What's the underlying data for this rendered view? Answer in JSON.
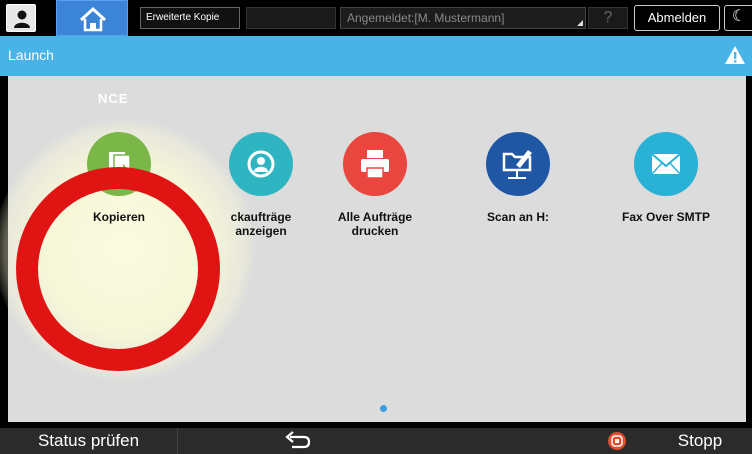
{
  "topbar": {
    "function_label": "Erweiterte Kopie",
    "login_text": "Angemeldet:[M. Mustermann]",
    "help_label": "?",
    "logout_label": "Abmelden",
    "moon_glyph": "☾"
  },
  "header": {
    "title": "Launch"
  },
  "main": {
    "section_label": "NCE",
    "apps": [
      {
        "line1": "Kopieren",
        "line2": "",
        "color": "#7ab648",
        "icon": "copy-icon"
      },
      {
        "line1": "ckaufträge",
        "line2": "anzeigen",
        "color": "#2fb5c2",
        "icon": "user-icon"
      },
      {
        "line1": "Alle Aufträge",
        "line2": "drucken",
        "color": "#e8463f",
        "icon": "printer-icon"
      },
      {
        "line1": "Scan an H:",
        "line2": "",
        "color": "#1f57a5",
        "icon": "scan-folder-icon"
      },
      {
        "line1": "Fax Over SMTP",
        "line2": "",
        "color": "#29b1d6",
        "icon": "envelope-icon"
      }
    ]
  },
  "bottombar": {
    "status_label": "Status prüfen",
    "stop_label": "Stopp"
  },
  "colors": {
    "header_blue": "#47b3e6",
    "home_blue": "#3b84d8",
    "annotation_red": "#e11414"
  }
}
